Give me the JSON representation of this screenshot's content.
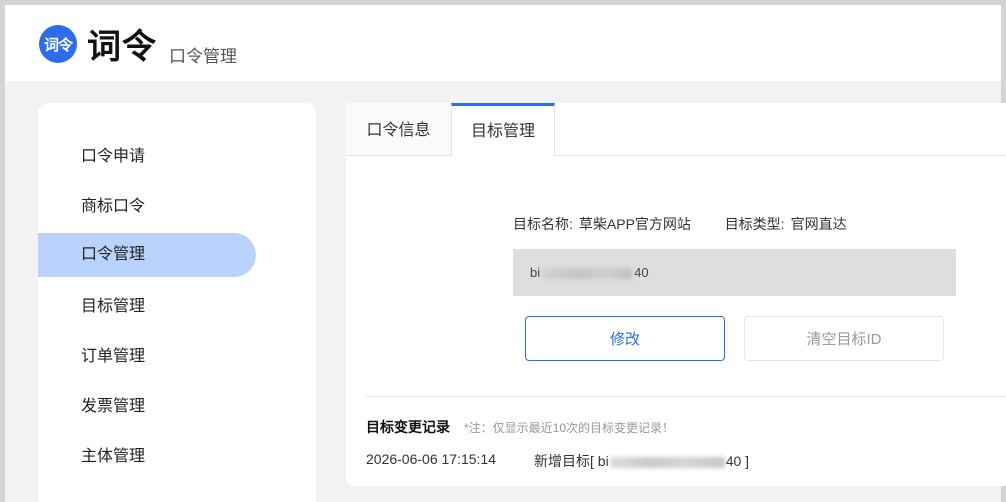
{
  "header": {
    "logo_text": "词令",
    "brand": "词令",
    "subtitle": "口令管理",
    "brand_color": "#2b6cf0"
  },
  "sidebar": {
    "items": [
      {
        "label": "口令申请",
        "active": false
      },
      {
        "label": "商标口令",
        "active": false
      },
      {
        "label": "口令管理",
        "active": true
      },
      {
        "label": "目标管理",
        "active": false
      },
      {
        "label": "订单管理",
        "active": false
      },
      {
        "label": "发票管理",
        "active": false
      },
      {
        "label": "主体管理",
        "active": false
      }
    ]
  },
  "main": {
    "tabs": [
      {
        "label": "口令信息",
        "active": false
      },
      {
        "label": "目标管理",
        "active": true
      }
    ],
    "target_name_label": "目标名称:",
    "target_name": "草柴APP官方网站",
    "target_type_label": "目标类型:",
    "target_type": "官网直达",
    "target_id_prefix": "bi",
    "target_id_suffix": "40",
    "buttons": {
      "edit": "修改",
      "clear": "清空目标ID"
    },
    "log": {
      "title": "目标变更记录",
      "note": "*注：仅显示最近10次的目标变更记录！",
      "entries": [
        {
          "time": "2026-06-06 17:15:14",
          "action_prefix": "新增目标[ bi",
          "action_suffix": "40 ]"
        }
      ]
    }
  }
}
